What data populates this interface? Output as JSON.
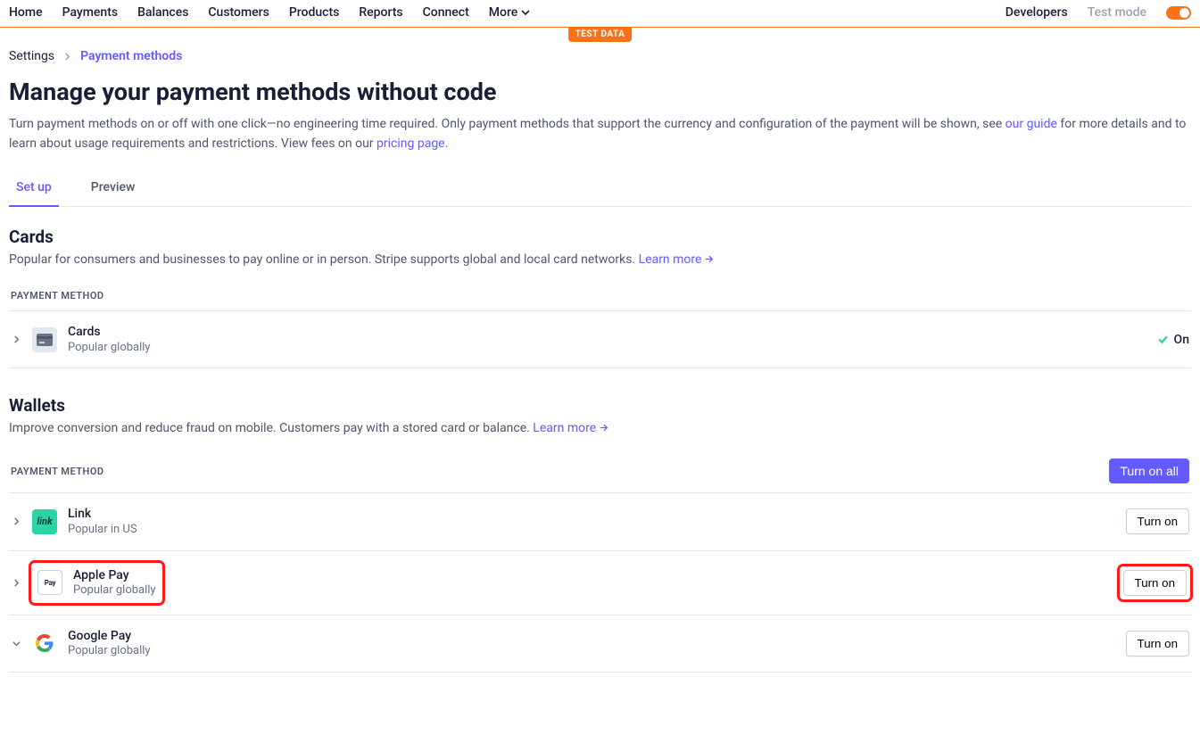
{
  "topnav": {
    "items": [
      "Home",
      "Payments",
      "Balances",
      "Customers",
      "Products",
      "Reports",
      "Connect",
      "More"
    ],
    "developers": "Developers",
    "test_mode_label": "Test mode"
  },
  "badge": "TEST DATA",
  "breadcrumbs": {
    "root": "Settings",
    "current": "Payment methods"
  },
  "title": "Manage your payment methods without code",
  "description": {
    "pre": "Turn payment methods on or off with one click—no engineering time required. Only payment methods that support the currency and configuration of the payment will be shown, see ",
    "guide_link": "our guide",
    "mid": " for more details and to learn about usage requirements and restrictions. View fees on our ",
    "pricing_link": "pricing page",
    "end": "."
  },
  "tabs": [
    "Set up",
    "Preview"
  ],
  "active_tab": 0,
  "cards_section": {
    "title": "Cards",
    "desc_pre": "Popular for consumers and businesses to pay online or in person. Stripe supports global and local card networks. ",
    "learn_more": "Learn more",
    "column_label": "PAYMENT METHOD",
    "row": {
      "name": "Cards",
      "sub": "Popular globally",
      "status_label": "On"
    }
  },
  "wallets_section": {
    "title": "Wallets",
    "desc_pre": "Improve conversion and reduce fraud on mobile. Customers pay with a stored card or balance. ",
    "learn_more": "Learn more",
    "column_label": "PAYMENT METHOD",
    "turn_on_all": "Turn on all",
    "rows": [
      {
        "name": "Link",
        "sub": "Popular in US",
        "action": "Turn on"
      },
      {
        "name": "Apple Pay",
        "sub": "Popular globally",
        "action": "Turn on"
      },
      {
        "name": "Google Pay",
        "sub": "Popular globally",
        "action": "Turn on"
      }
    ]
  }
}
